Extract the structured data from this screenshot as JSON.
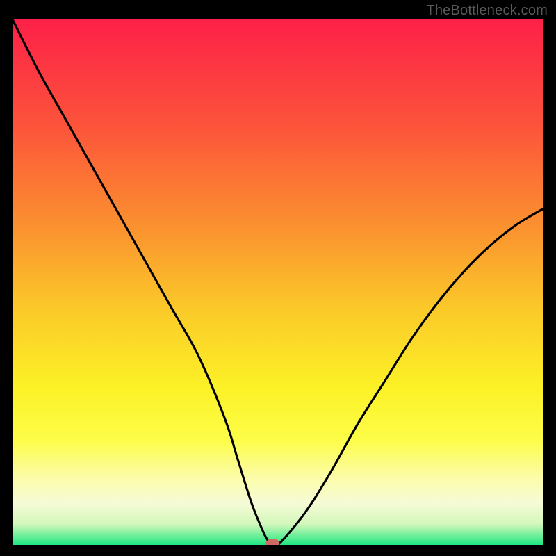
{
  "watermark": "TheBottleneck.com",
  "chart_data": {
    "type": "line",
    "title": "",
    "xlabel": "",
    "ylabel": "",
    "xlim": [
      0,
      100
    ],
    "ylim": [
      0,
      100
    ],
    "x": [
      0,
      5,
      10,
      15,
      20,
      25,
      30,
      35,
      40,
      42.5,
      45,
      47,
      48,
      49,
      50,
      55,
      60,
      65,
      70,
      75,
      80,
      85,
      90,
      95,
      100
    ],
    "values": [
      100,
      90,
      81,
      72,
      63,
      54,
      45,
      36,
      24,
      16,
      8,
      3,
      1,
      0,
      0,
      6,
      14,
      23,
      31,
      39,
      46,
      52,
      57,
      61,
      64
    ],
    "marker": {
      "x": 49,
      "y": 0
    },
    "gradient_stops": [
      {
        "offset": 0,
        "color": "#fd2048"
      },
      {
        "offset": 20,
        "color": "#fc533b"
      },
      {
        "offset": 40,
        "color": "#fb932f"
      },
      {
        "offset": 55,
        "color": "#fbc929"
      },
      {
        "offset": 70,
        "color": "#fcf126"
      },
      {
        "offset": 80,
        "color": "#fdfd48"
      },
      {
        "offset": 87,
        "color": "#fcfca6"
      },
      {
        "offset": 92,
        "color": "#f6fbd6"
      },
      {
        "offset": 96,
        "color": "#d4f7bb"
      },
      {
        "offset": 100,
        "color": "#1ee880"
      }
    ],
    "curve_color": "#000000",
    "curve_width": 3.2,
    "marker_color": "#cf6c62",
    "marker_rx": 10,
    "marker_ry": 7
  }
}
